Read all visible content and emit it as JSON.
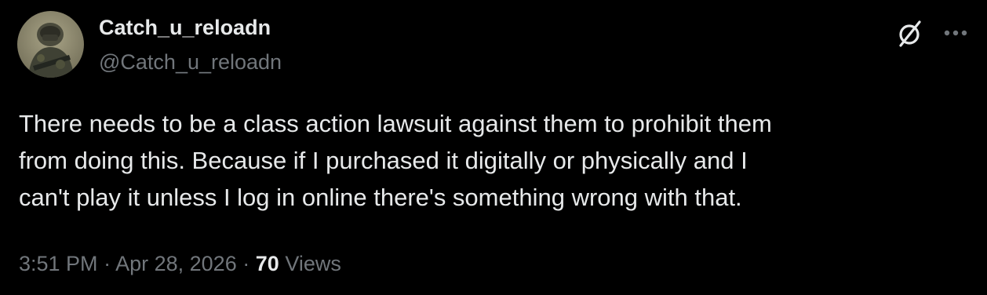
{
  "author": {
    "display_name": "Catch_u_reloadn",
    "handle": "@Catch_u_reloadn",
    "avatar_icon": "soldier-avatar"
  },
  "header_actions": {
    "grok_icon": "grok-icon",
    "more_icon": "more-icon"
  },
  "tweet": {
    "lines": [
      "There needs to be a class action lawsuit against them to prohibit them",
      "from doing this. Because if I purchased it digitally or physically and I",
      "can't play it unless I log in online there's something wrong with that."
    ]
  },
  "meta": {
    "time": "3:51 PM",
    "separator": "·",
    "date": "Apr 28, 2026",
    "views_count": "70",
    "views_label": "Views"
  },
  "colors": {
    "background": "#000000",
    "text_primary": "#e7e9ea",
    "text_secondary": "#71767b"
  }
}
